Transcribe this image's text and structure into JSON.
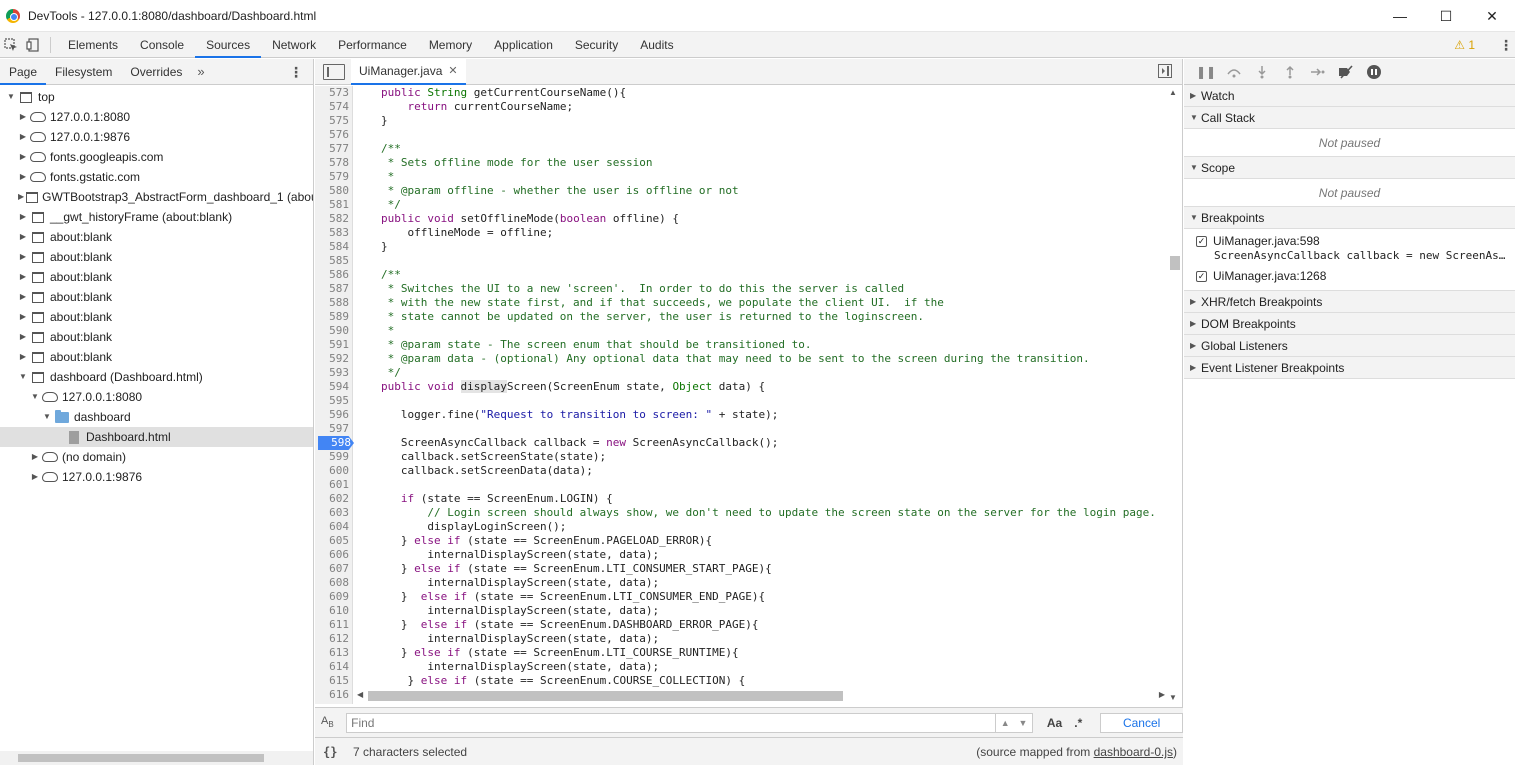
{
  "window": {
    "title": "DevTools - 127.0.0.1:8080/dashboard/Dashboard.html",
    "minimize": "—",
    "maximize": "☐",
    "close": "✕"
  },
  "toolbar": {
    "tabs": [
      "Elements",
      "Console",
      "Sources",
      "Network",
      "Performance",
      "Memory",
      "Application",
      "Security",
      "Audits"
    ],
    "active_tab": "Sources",
    "warning_count": "1"
  },
  "navigator": {
    "tabs": [
      "Page",
      "Filesystem",
      "Overrides"
    ],
    "more": "»",
    "tree": [
      {
        "label": "top",
        "depth": 0,
        "icon": "frame-icon",
        "expanded": true
      },
      {
        "label": "127.0.0.1:8080",
        "depth": 1,
        "icon": "cloud-icon",
        "expanded": false
      },
      {
        "label": "127.0.0.1:9876",
        "depth": 1,
        "icon": "cloud-icon",
        "expanded": false
      },
      {
        "label": "fonts.googleapis.com",
        "depth": 1,
        "icon": "cloud-icon",
        "expanded": false
      },
      {
        "label": "fonts.gstatic.com",
        "depth": 1,
        "icon": "cloud-icon",
        "expanded": false
      },
      {
        "label": "GWTBootstrap3_AbstractForm_dashboard_1 (about:blank)",
        "depth": 1,
        "icon": "frame-icon",
        "expanded": false
      },
      {
        "label": "__gwt_historyFrame (about:blank)",
        "depth": 1,
        "icon": "frame-icon",
        "expanded": false
      },
      {
        "label": "about:blank",
        "depth": 1,
        "icon": "frame-icon",
        "expanded": false
      },
      {
        "label": "about:blank",
        "depth": 1,
        "icon": "frame-icon",
        "expanded": false
      },
      {
        "label": "about:blank",
        "depth": 1,
        "icon": "frame-icon",
        "expanded": false
      },
      {
        "label": "about:blank",
        "depth": 1,
        "icon": "frame-icon",
        "expanded": false
      },
      {
        "label": "about:blank",
        "depth": 1,
        "icon": "frame-icon",
        "expanded": false
      },
      {
        "label": "about:blank",
        "depth": 1,
        "icon": "frame-icon",
        "expanded": false
      },
      {
        "label": "about:blank",
        "depth": 1,
        "icon": "frame-icon",
        "expanded": false
      },
      {
        "label": "dashboard (Dashboard.html)",
        "depth": 1,
        "icon": "frame-icon",
        "expanded": true
      },
      {
        "label": "127.0.0.1:8080",
        "depth": 2,
        "icon": "cloud-icon",
        "expanded": true
      },
      {
        "label": "dashboard",
        "depth": 3,
        "icon": "folder-icon",
        "expanded": true
      },
      {
        "label": "Dashboard.html",
        "depth": 4,
        "icon": "file-icon",
        "leaf": true,
        "selected": true
      },
      {
        "label": "(no domain)",
        "depth": 2,
        "icon": "cloud-icon",
        "expanded": false
      },
      {
        "label": "127.0.0.1:9876",
        "depth": 2,
        "icon": "cloud-icon",
        "expanded": false
      }
    ]
  },
  "editor": {
    "file_tab": "UiManager.java",
    "breakpoint_line": "598",
    "lines": [
      {
        "n": "573",
        "code": "public String getCurrentCourseName(){"
      },
      {
        "n": "574",
        "code": "    return currentCourseName;"
      },
      {
        "n": "575",
        "code": "}"
      },
      {
        "n": "576",
        "code": ""
      },
      {
        "n": "577",
        "code": "/**"
      },
      {
        "n": "578",
        "code": " * Sets offline mode for the user session"
      },
      {
        "n": "579",
        "code": " *"
      },
      {
        "n": "580",
        "code": " * @param offline - whether the user is offline or not"
      },
      {
        "n": "581",
        "code": " */"
      },
      {
        "n": "582",
        "code": "public void setOfflineMode(boolean offline) {"
      },
      {
        "n": "583",
        "code": "    offlineMode = offline;"
      },
      {
        "n": "584",
        "code": "}"
      },
      {
        "n": "585",
        "code": ""
      },
      {
        "n": "586",
        "code": "/**"
      },
      {
        "n": "587",
        "code": " * Switches the UI to a new 'screen'.  In order to do this the server is called"
      },
      {
        "n": "588",
        "code": " * with the new state first, and if that succeeds, we populate the client UI.  if the"
      },
      {
        "n": "589",
        "code": " * state cannot be updated on the server, the user is returned to the loginscreen."
      },
      {
        "n": "590",
        "code": " *"
      },
      {
        "n": "591",
        "code": " * @param state - The screen enum that should be transitioned to."
      },
      {
        "n": "592",
        "code": " * @param data - (optional) Any optional data that may need to be sent to the screen during the transition."
      },
      {
        "n": "593",
        "code": " */"
      },
      {
        "n": "594",
        "code": "public void displayScreen(ScreenEnum state, Object data) {"
      },
      {
        "n": "595",
        "code": ""
      },
      {
        "n": "596",
        "code": "   logger.fine(\"Request to transition to screen: \" + state);"
      },
      {
        "n": "597",
        "code": ""
      },
      {
        "n": "598",
        "code": "   ScreenAsyncCallback callback = new ScreenAsyncCallback();"
      },
      {
        "n": "599",
        "code": "   callback.setScreenState(state);"
      },
      {
        "n": "600",
        "code": "   callback.setScreenData(data);"
      },
      {
        "n": "601",
        "code": ""
      },
      {
        "n": "602",
        "code": "   if (state == ScreenEnum.LOGIN) {"
      },
      {
        "n": "603",
        "code": "       // Login screen should always show, we don't need to update the screen state on the server for the login page."
      },
      {
        "n": "604",
        "code": "       displayLoginScreen();"
      },
      {
        "n": "605",
        "code": "   } else if (state == ScreenEnum.PAGELOAD_ERROR){"
      },
      {
        "n": "606",
        "code": "       internalDisplayScreen(state, data);"
      },
      {
        "n": "607",
        "code": "   } else if (state == ScreenEnum.LTI_CONSUMER_START_PAGE){"
      },
      {
        "n": "608",
        "code": "       internalDisplayScreen(state, data);"
      },
      {
        "n": "609",
        "code": "   }  else if (state == ScreenEnum.LTI_CONSUMER_END_PAGE){"
      },
      {
        "n": "610",
        "code": "       internalDisplayScreen(state, data);"
      },
      {
        "n": "611",
        "code": "   }  else if (state == ScreenEnum.DASHBOARD_ERROR_PAGE){"
      },
      {
        "n": "612",
        "code": "       internalDisplayScreen(state, data);"
      },
      {
        "n": "613",
        "code": "   } else if (state == ScreenEnum.LTI_COURSE_RUNTIME){"
      },
      {
        "n": "614",
        "code": "       internalDisplayScreen(state, data);"
      },
      {
        "n": "615",
        "code": "    } else if (state == ScreenEnum.COURSE_COLLECTION) {"
      },
      {
        "n": "616",
        "code": ""
      }
    ]
  },
  "find": {
    "placeholder": "Find",
    "value": "",
    "case_label": "Aa",
    "regex_label": ".*",
    "cancel_label": "Cancel"
  },
  "status": {
    "pretty_print": "{}",
    "selection": "7 characters selected",
    "source_mapped_prefix": "(source mapped from ",
    "source_mapped_link": "dashboard-0.js",
    "source_mapped_suffix": ")"
  },
  "debugger": {
    "sections": {
      "watch": "Watch",
      "call_stack": "Call Stack",
      "scope": "Scope",
      "breakpoints": "Breakpoints",
      "xhr": "XHR/fetch Breakpoints",
      "dom": "DOM Breakpoints",
      "global": "Global Listeners",
      "event": "Event Listener Breakpoints"
    },
    "not_paused": "Not paused",
    "breakpoints": [
      {
        "location": "UiManager.java:598",
        "code": "ScreenAsyncCallback callback = new ScreenAs…",
        "checked": true
      },
      {
        "location": "UiManager.java:1268",
        "code": "",
        "checked": true
      }
    ]
  },
  "colors": {
    "accent": "#1a73e8",
    "breakpoint": "#4285f4",
    "keyword": "#881280",
    "comment": "#236e25",
    "string": "#1a1aa6"
  }
}
